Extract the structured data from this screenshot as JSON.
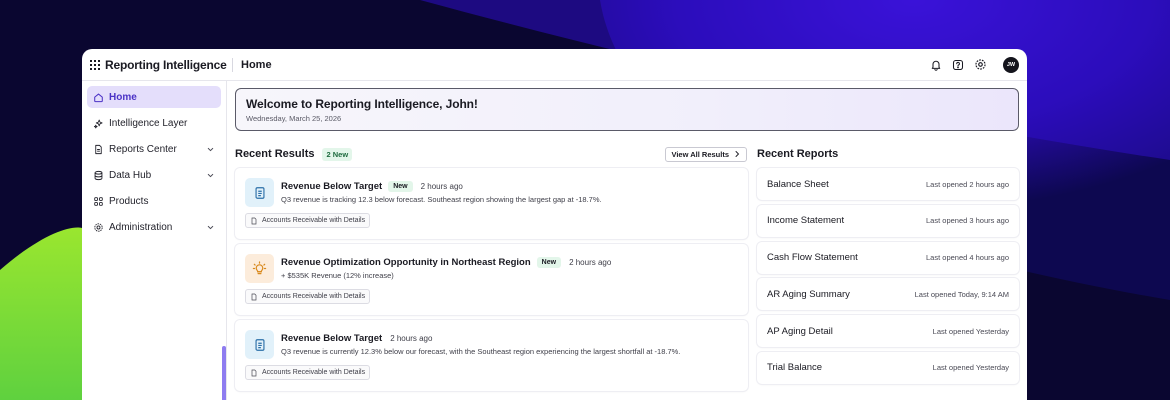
{
  "app": {
    "name": "Reporting Intelligence",
    "page": "Home",
    "avatar_initials": "JW"
  },
  "colors": {
    "accent": "#4b32c6",
    "active_bg": "#e4defb",
    "new_badge_bg": "#e3f6ea",
    "bg_dark": "#0a0630",
    "bg_purple": "#3a10d8",
    "bg_green": "#7be038"
  },
  "header": {
    "icons": [
      "bell-icon",
      "help-icon",
      "settings-gear-icon"
    ]
  },
  "sidebar": {
    "items": [
      {
        "label": "Home",
        "icon": "home-icon",
        "active": true,
        "expandable": false
      },
      {
        "label": "Intelligence Layer",
        "icon": "sparkle-icon",
        "active": false,
        "expandable": false
      },
      {
        "label": "Reports Center",
        "icon": "document-icon",
        "active": false,
        "expandable": true
      },
      {
        "label": "Data Hub",
        "icon": "database-icon",
        "active": false,
        "expandable": true
      },
      {
        "label": "Products",
        "icon": "grid-icon",
        "active": false,
        "expandable": false
      },
      {
        "label": "Administration",
        "icon": "gear-icon",
        "active": false,
        "expandable": true
      }
    ]
  },
  "welcome": {
    "title": "Welcome to Reporting Intelligence, John!",
    "date": "Wednesday, March 25, 2026"
  },
  "recent_results": {
    "title": "Recent Results",
    "new_count": "2 New",
    "view_all": "View All Results",
    "cards": [
      {
        "icon": "document-icon",
        "icon_tone": "blue",
        "title": "Revenue Below Target",
        "badge": "New",
        "time": "2 hours ago",
        "description": "Q3 revenue is tracking 12.3 below forecast. Southeast region showing the largest gap at -18.7%.",
        "tag": "Accounts Receivable with Details"
      },
      {
        "icon": "lightbulb-icon",
        "icon_tone": "orange",
        "title": "Revenue Optimization Opportunity in Northeast Region",
        "badge": "New",
        "time": "2 hours ago",
        "description": "+ $535K Revenue (12% increase)",
        "tag": "Accounts Receivable with Details"
      },
      {
        "icon": "document-icon",
        "icon_tone": "blue",
        "title": "Revenue Below Target",
        "badge": "",
        "time": "2 hours ago",
        "description": "Q3 revenue is currently 12.3% below our forecast, with the Southeast region experiencing the largest shortfall at -18.7%.",
        "tag": "Accounts Receivable with Details"
      }
    ]
  },
  "recent_reports": {
    "title": "Recent Reports",
    "items": [
      {
        "name": "Balance Sheet",
        "meta": "Last opened 2 hours ago"
      },
      {
        "name": "Income Statement",
        "meta": "Last opened 3 hours ago"
      },
      {
        "name": "Cash Flow Statement",
        "meta": "Last opened 4 hours ago"
      },
      {
        "name": "AR Aging Summary",
        "meta": "Last opened Today, 9:14 AM"
      },
      {
        "name": "AP Aging Detail",
        "meta": "Last opened Yesterday"
      },
      {
        "name": "Trial Balance",
        "meta": "Last opened Yesterday"
      }
    ]
  }
}
